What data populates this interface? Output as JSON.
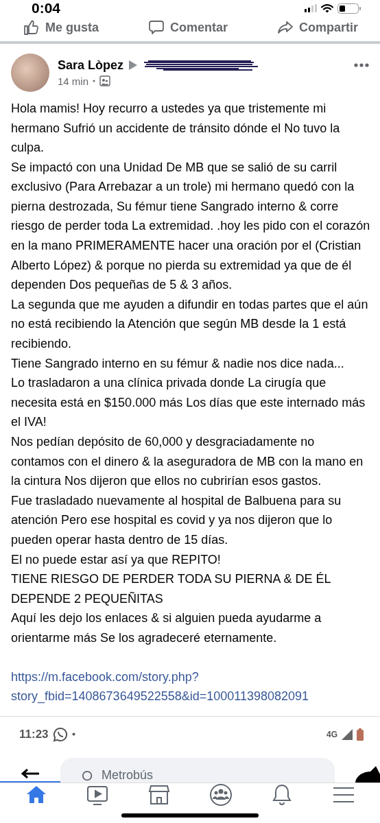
{
  "status_bar": {
    "time": "0:04"
  },
  "actions": [
    {
      "kind": "like",
      "label": "Me gusta"
    },
    {
      "kind": "comment",
      "label": "Comentar"
    },
    {
      "kind": "share",
      "label": "Compartir"
    }
  ],
  "post": {
    "author": "Sara Lòpez",
    "time": "14 min",
    "paragraphs": [
      "Hola mamis! Hoy recurro a ustedes ya que tristemente mi hermano Sufrió un accidente de tránsito dónde el No tuvo la culpa.",
      "Se impactó con una Unidad De MB que se salió de su carril exclusivo (Para Arrebazar a un trole) mi hermano quedó con la pierna destrozada, Su fémur tiene Sangrado interno & corre riesgo de perder toda La extremidad. .hoy les pido con el corazón en la mano PRIMERAMENTE hacer una oración por el (Cristian Alberto López) & porque no pierda su extremidad ya que de él dependen Dos pequeñas de 5 & 3 años.",
      "La segunda que me ayuden a difundir en todas partes que el aún no está recibiendo la Atención que según MB desde la 1 está recibiendo.",
      "Tiene Sangrado interno en su fémur & nadie nos dice nada...",
      "Lo trasladaron a una clínica privada donde La cirugía que necesita está en $150.000 más Los días que este internado más el IVA!",
      "Nos pedían depósito de 60,000 y desgraciadamente no contamos con el dinero & la aseguradora de MB con la mano en la cintura Nos dijeron que ellos no cubrirían esos gastos.",
      "Fue trasladado nuevamente al hospital de Balbuena para su atención Pero ese hospital es covid y ya nos dijeron que lo pueden operar hasta dentro de 15 días.",
      "El no puede estar así ya que REPITO!",
      "TIENE RIESGO DE PERDER TODA SU PIERNA & DE ÉL DEPENDE 2 PEQUEÑITAS",
      "Aquí les dejo los enlaces & si alguien pueda ayudarme a orientarme más Se los agradeceré eternamente."
    ],
    "link": "https://m.facebook.com/story.php?story_fbid=1408673649522558&id=100011398082091"
  },
  "embedded_screenshot": {
    "time": "11:23",
    "network": "4G",
    "search_placeholder": "Metrobús"
  },
  "nav_tabs": [
    {
      "kind": "home",
      "selected": true
    },
    {
      "kind": "video",
      "selected": false
    },
    {
      "kind": "store",
      "selected": false
    },
    {
      "kind": "groups",
      "selected": false
    },
    {
      "kind": "bell",
      "selected": false
    },
    {
      "kind": "menu",
      "selected": false
    }
  ]
}
